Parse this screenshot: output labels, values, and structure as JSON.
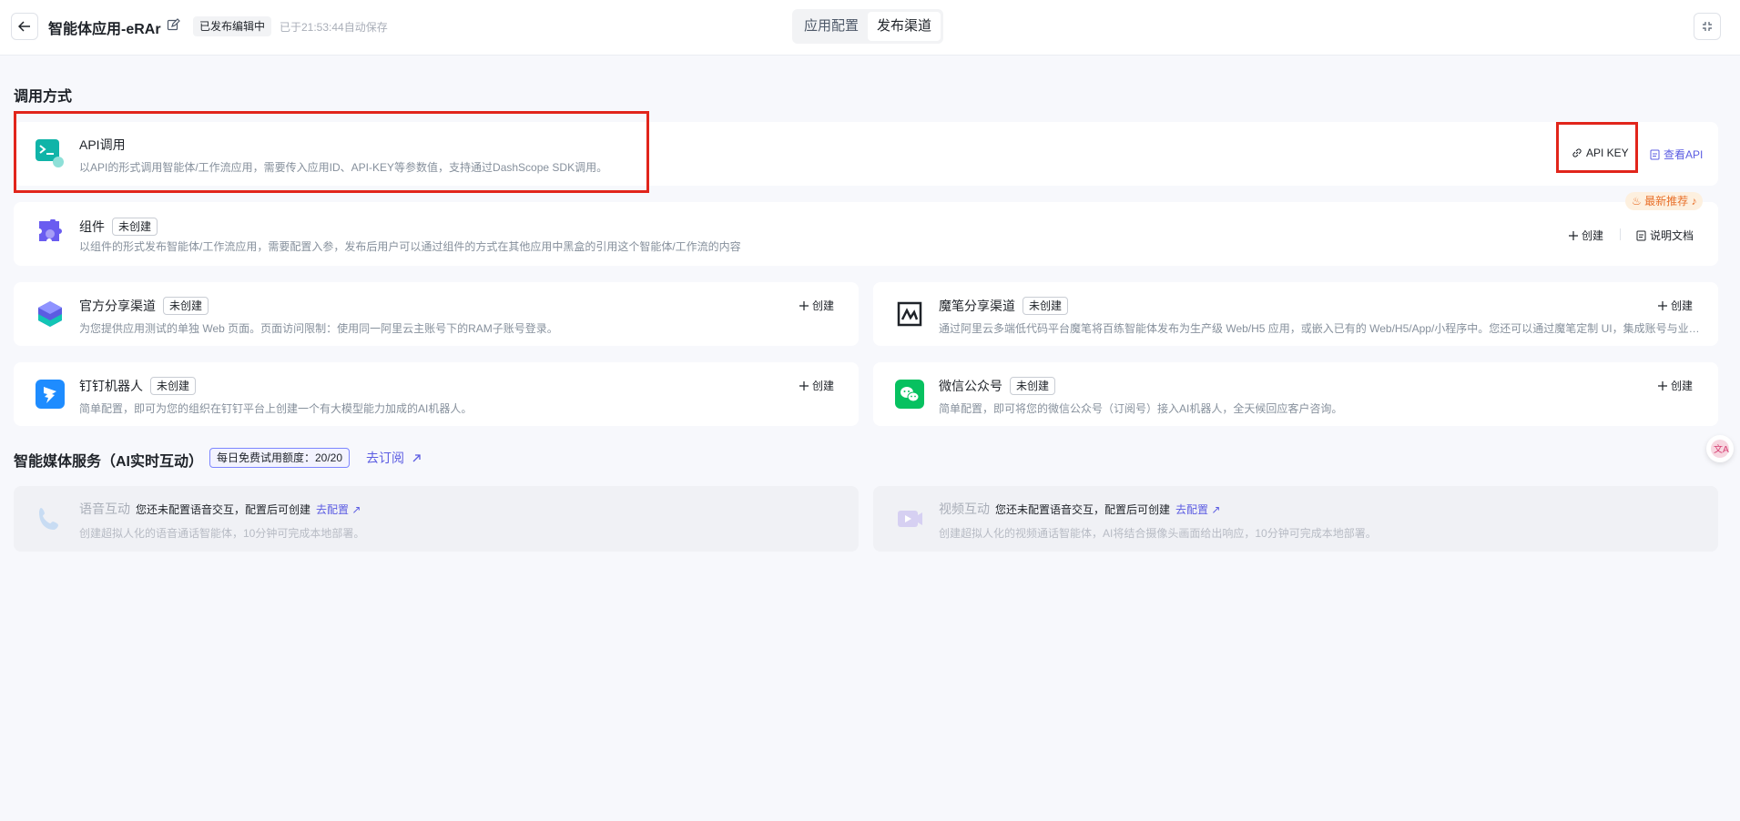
{
  "header": {
    "app_title": "智能体应用-eRAr",
    "status": "已发布编辑中",
    "autosave": "已于21:53:44自动保存",
    "tabs": [
      {
        "label": "应用配置",
        "active": false
      },
      {
        "label": "发布渠道",
        "active": true
      }
    ]
  },
  "invoke_section": {
    "title": "调用方式",
    "api": {
      "title": "API调用",
      "desc": "以API的形式调用智能体/工作流应用，需要传入应用ID、API-KEY等参数值，支持通过DashScope SDK调用。",
      "api_key_label": "API KEY",
      "view_api_label": "查看API"
    },
    "component": {
      "title": "组件",
      "tag": "未创建",
      "desc": "以组件的形式发布智能体/工作流应用，需要配置入参，发布后用户可以通过组件的方式在其他应用中黑盒的引用这个智能体/工作流的内容",
      "badge": "最新推荐",
      "create_label": "创建",
      "docs_label": "说明文档"
    },
    "channels": [
      {
        "key": "official",
        "title": "官方分享渠道",
        "tag": "未创建",
        "desc": "为您提供应用测试的单独 Web 页面。页面访问限制：使用同一阿里云主账号下的RAM子账号登录。",
        "create_label": "创建",
        "icon": "official-share-icon"
      },
      {
        "key": "mobi",
        "title": "魔笔分享渠道",
        "tag": "未创建",
        "desc": "通过阿里云多端低代码平台魔笔将百练智能体发布为生产级 Web/H5 应用，或嵌入已有的 Web/H5/App/小程序中。您还可以通过魔笔定制 UI，集成账号与业务系统。",
        "create_label": "创建",
        "icon": "mobi-icon"
      },
      {
        "key": "dingtalk",
        "title": "钉钉机器人",
        "tag": "未创建",
        "desc": "简单配置，即可为您的组织在钉钉平台上创建一个有大模型能力加成的AI机器人。",
        "create_label": "创建",
        "icon": "dingtalk-icon"
      },
      {
        "key": "wechat",
        "title": "微信公众号",
        "tag": "未创建",
        "desc": "简单配置，即可将您的微信公众号（订阅号）接入AI机器人，全天候回应客户咨询。",
        "create_label": "创建",
        "icon": "wechat-icon"
      }
    ]
  },
  "media_section": {
    "title": "智能媒体服务（AI实时互动）",
    "quota": "每日免费试用额度：20/20",
    "subscribe_label": "去订阅",
    "voice": {
      "title": "语音互动",
      "note": "您还未配置语音交互，配置后可创建",
      "link": "去配置",
      "desc": "创建超拟人化的语音通话智能体，10分钟可完成本地部署。"
    },
    "video": {
      "title": "视频互动",
      "note": "您还未配置语音交互，配置后可创建",
      "link": "去配置",
      "desc": "创建超拟人化的视频通话智能体，AI将结合摄像头画面给出响应，10分钟可完成本地部署。"
    }
  },
  "colors": {
    "accent": "#5b5ce2",
    "highlight_border": "#e1251b",
    "badge_orange": "#e8702a"
  }
}
